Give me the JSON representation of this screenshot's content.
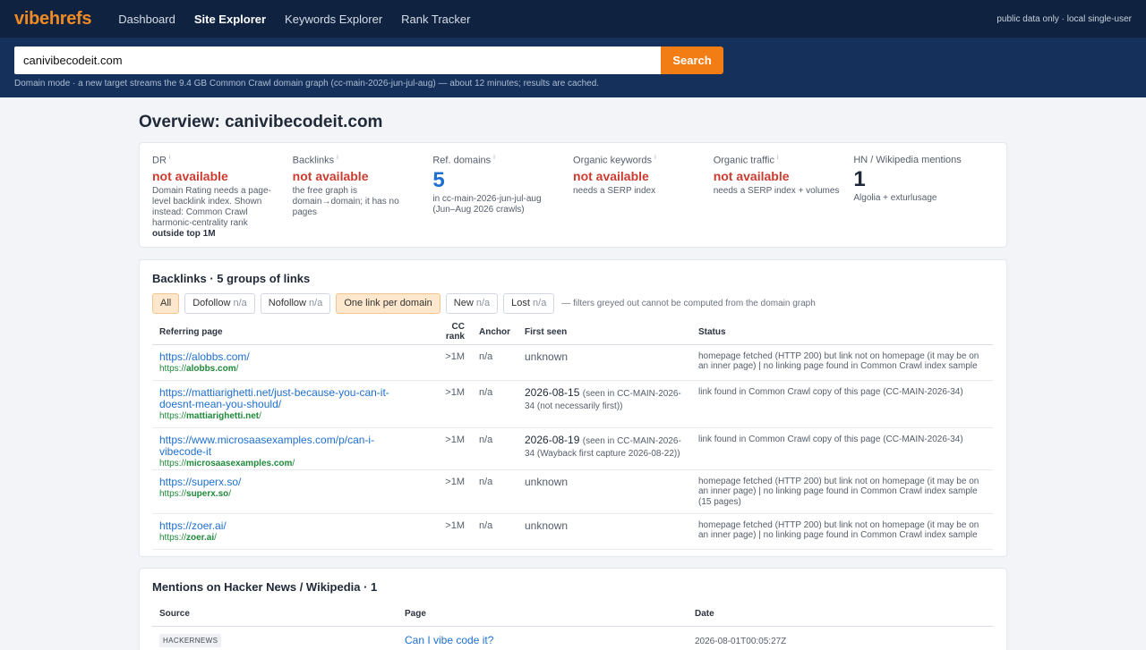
{
  "nav": {
    "logo": "vibehrefs",
    "items": [
      "Dashboard",
      "Site Explorer",
      "Keywords Explorer",
      "Rank Tracker"
    ],
    "right_text": "public data only · local single-user"
  },
  "search": {
    "value": "canivibecodeit.com",
    "button": "Search",
    "hint": "Domain mode · a new target streams the 9.4 GB Common Crawl domain graph (cc-main-2026-jun-jul-aug) — about 12 minutes; results are cached."
  },
  "overview": {
    "title": "Overview: canivibecodeit.com",
    "info_mark": "i",
    "dr": {
      "label": "DR",
      "value": "not available",
      "sub": "Domain Rating needs a page-level backlink index. Shown instead: Common Crawl harmonic-centrality rank ",
      "sub_bold": "outside top 1M"
    },
    "backlinks": {
      "label": "Backlinks",
      "value": "not available",
      "sub": "the free graph is domain→domain; it has no pages"
    },
    "ref_domains": {
      "label": "Ref. domains",
      "value": "5",
      "sub": "in cc-main-2026-jun-jul-aug (Jun–Aug 2026 crawls)"
    },
    "organic_keywords": {
      "label": "Organic keywords",
      "value": "not available",
      "sub": "needs a SERP index"
    },
    "organic_traffic": {
      "label": "Organic traffic",
      "value": "not available",
      "sub": "needs a SERP index + volumes"
    },
    "mentions": {
      "label": "HN / Wikipedia mentions",
      "value": "1",
      "sub": "Algolia + exturlusage"
    }
  },
  "backlinks": {
    "title": "Backlinks · 5 groups of links",
    "filters": {
      "all": "All",
      "dofollow": "Dofollow",
      "nofollow": "Nofollow",
      "one_per_domain": "One link per domain",
      "new": "New",
      "lost": "Lost",
      "na": "n/a"
    },
    "filter_note": "— filters greyed out cannot be computed from the domain graph",
    "columns": [
      "Referring page",
      "CC rank",
      "Anchor",
      "First seen",
      "Status"
    ],
    "rows": [
      {
        "url": "https://alobbs.com/",
        "proto": "https://",
        "domain": "alobbs.com",
        "slash": "/",
        "cc_rank": ">1M",
        "anchor": "n/a",
        "first_seen": "unknown",
        "first_seen_note": "",
        "status": "homepage fetched (HTTP 200) but link not on homepage (it may be on an inner page) | no linking page found in Common Crawl index sample"
      },
      {
        "url": "https://mattiarighetti.net/just-because-you-can-it-doesnt-mean-you-should/",
        "proto": "https://",
        "domain": "mattiarighetti.net",
        "slash": "/",
        "cc_rank": ">1M",
        "anchor": "n/a",
        "first_seen": "2026-08-15",
        "first_seen_note": "(seen in CC-MAIN-2026-34 (not necessarily first))",
        "status": "link found in Common Crawl copy of this page (CC-MAIN-2026-34)"
      },
      {
        "url": "https://www.microsaasexamples.com/p/can-i-vibecode-it",
        "proto": "https://",
        "domain": "microsaasexamples.com",
        "slash": "/",
        "cc_rank": ">1M",
        "anchor": "n/a",
        "first_seen": "2026-08-19",
        "first_seen_note": "(seen in CC-MAIN-2026-34 (Wayback first capture 2026-08-22))",
        "status": "link found in Common Crawl copy of this page (CC-MAIN-2026-34)"
      },
      {
        "url": "https://superx.so/",
        "proto": "https://",
        "domain": "superx.so",
        "slash": "/",
        "cc_rank": ">1M",
        "anchor": "n/a",
        "first_seen": "unknown",
        "first_seen_note": "",
        "status": "homepage fetched (HTTP 200) but link not on homepage (it may be on an inner page) | no linking page found in Common Crawl index sample (15 pages)"
      },
      {
        "url": "https://zoer.ai/",
        "proto": "https://",
        "domain": "zoer.ai",
        "slash": "/",
        "cc_rank": ">1M",
        "anchor": "n/a",
        "first_seen": "unknown",
        "first_seen_note": "",
        "status": "homepage fetched (HTTP 200) but link not on homepage (it may be on an inner page) | no linking page found in Common Crawl index sample"
      }
    ]
  },
  "mentions": {
    "title": "Mentions on Hacker News / Wikipedia · 1",
    "columns": [
      "Source",
      "Page",
      "Date"
    ],
    "rows": [
      {
        "source": "HACKERNEWS",
        "page": "Can I vibe code it?",
        "date": "2026-08-01T00:05:27Z"
      }
    ]
  },
  "colors": {
    "nav_bg": "#0f2340",
    "search_bg": "#15305a",
    "accent": "#f27d14",
    "link": "#1e6fd0",
    "domain_green": "#1f8a3a",
    "not_available_red": "#cc3b2f"
  }
}
